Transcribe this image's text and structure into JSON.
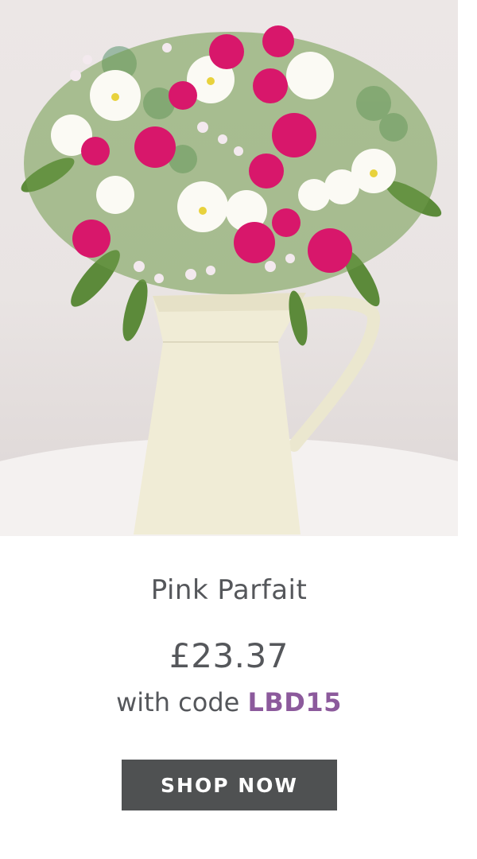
{
  "product": {
    "name": "Pink Parfait",
    "price": "£23.37",
    "code_prefix": "with code",
    "code": "LBD15"
  },
  "cta": {
    "label": "SHOP NOW"
  },
  "colors": {
    "text": "#55575b",
    "code": "#8c5a9c",
    "button_bg": "#4f5152",
    "button_text": "#ffffff"
  }
}
